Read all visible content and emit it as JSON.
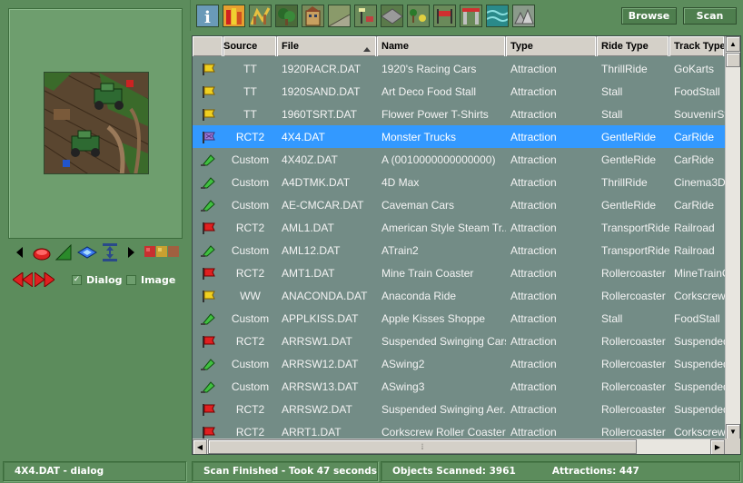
{
  "left_panel": {
    "checkbox_dialog": {
      "label": "Dialog",
      "checked": true
    },
    "checkbox_image": {
      "label": "Image",
      "checked": false
    }
  },
  "toolbar": {
    "browse_label": "Browse",
    "scan_label": "Scan",
    "icons": [
      "info-icon",
      "ride-icon",
      "tracked-ride-icon",
      "tree-icon",
      "building-icon",
      "wall-icon",
      "path-addition-icon",
      "path-icon",
      "scenery-small-icon",
      "banner-icon",
      "entrance-icon",
      "water-icon",
      "scenery-group-icon"
    ]
  },
  "table": {
    "columns": [
      "",
      "Source",
      "File",
      "Name",
      "Type",
      "Ride Type",
      "Track Type"
    ],
    "sort_column": "File",
    "selected_row": 3,
    "rows": [
      {
        "flag": "yellow",
        "source": "TT",
        "file": "1920RACR.DAT",
        "name": "1920's Racing Cars",
        "type": "Attraction",
        "ride_type": "ThrillRide",
        "track_type": "GoKarts"
      },
      {
        "flag": "yellow",
        "source": "TT",
        "file": "1920SAND.DAT",
        "name": "Art Deco Food Stall",
        "type": "Attraction",
        "ride_type": "Stall",
        "track_type": "FoodStall"
      },
      {
        "flag": "yellow",
        "source": "TT",
        "file": "1960TSRT.DAT",
        "name": "Flower Power T-Shirts",
        "type": "Attraction",
        "ride_type": "Stall",
        "track_type": "SouvenirStall"
      },
      {
        "flag": "purple",
        "source": "RCT2",
        "file": "4X4.DAT",
        "name": "Monster Trucks",
        "type": "Attraction",
        "ride_type": "GentleRide",
        "track_type": "CarRide"
      },
      {
        "flag": "green",
        "source": "Custom",
        "file": "4X40Z.DAT",
        "name": "A (0010000000000000)",
        "type": "Attraction",
        "ride_type": "GentleRide",
        "track_type": "CarRide"
      },
      {
        "flag": "green",
        "source": "Custom",
        "file": "A4DTMK.DAT",
        "name": "4D Max",
        "type": "Attraction",
        "ride_type": "ThrillRide",
        "track_type": "Cinema3D"
      },
      {
        "flag": "green",
        "source": "Custom",
        "file": "AE-CMCAR.DAT",
        "name": "Caveman Cars",
        "type": "Attraction",
        "ride_type": "GentleRide",
        "track_type": "CarRide"
      },
      {
        "flag": "red",
        "source": "RCT2",
        "file": "AML1.DAT",
        "name": "American Style Steam Tr...",
        "type": "Attraction",
        "ride_type": "TransportRide",
        "track_type": "Railroad"
      },
      {
        "flag": "green",
        "source": "Custom",
        "file": "AML12.DAT",
        "name": "ATrain2",
        "type": "Attraction",
        "ride_type": "TransportRide",
        "track_type": "Railroad"
      },
      {
        "flag": "red",
        "source": "RCT2",
        "file": "AMT1.DAT",
        "name": "Mine Train Coaster",
        "type": "Attraction",
        "ride_type": "Rollercoaster",
        "track_type": "MineTrainCoaster"
      },
      {
        "flag": "yellow",
        "source": "WW",
        "file": "ANACONDA.DAT",
        "name": "Anaconda Ride",
        "type": "Attraction",
        "ride_type": "Rollercoaster",
        "track_type": "CorkscrewRollerCoaster"
      },
      {
        "flag": "green",
        "source": "Custom",
        "file": "APPLKISS.DAT",
        "name": "Apple Kisses  Shoppe",
        "type": "Attraction",
        "ride_type": "Stall",
        "track_type": "FoodStall"
      },
      {
        "flag": "red",
        "source": "RCT2",
        "file": "ARRSW1.DAT",
        "name": "Suspended Swinging Cars",
        "type": "Attraction",
        "ride_type": "Rollercoaster",
        "track_type": "SuspendedSwinging"
      },
      {
        "flag": "green",
        "source": "Custom",
        "file": "ARRSW12.DAT",
        "name": "ASwing2",
        "type": "Attraction",
        "ride_type": "Rollercoaster",
        "track_type": "SuspendedSwinging"
      },
      {
        "flag": "green",
        "source": "Custom",
        "file": "ARRSW13.DAT",
        "name": "ASwing3",
        "type": "Attraction",
        "ride_type": "Rollercoaster",
        "track_type": "SuspendedSwinging"
      },
      {
        "flag": "red",
        "source": "RCT2",
        "file": "ARRSW2.DAT",
        "name": "Suspended Swinging Aer...",
        "type": "Attraction",
        "ride_type": "Rollercoaster",
        "track_type": "SuspendedSwinging"
      },
      {
        "flag": "red",
        "source": "RCT2",
        "file": "ARRT1.DAT",
        "name": "Corkscrew Roller Coaster",
        "type": "Attraction",
        "ride_type": "Rollercoaster",
        "track_type": "CorkscrewRollerCoaster"
      }
    ]
  },
  "status": {
    "selection": "4X4.DAT - dialog",
    "scan": "Scan Finished - Took 47 seconds",
    "objects_scanned": "Objects Scanned: 3961",
    "attractions": "Attractions: 447"
  },
  "colors": {
    "background": "#5c8c5c",
    "table_bg": "#738c86",
    "selection": "#3399ff"
  }
}
